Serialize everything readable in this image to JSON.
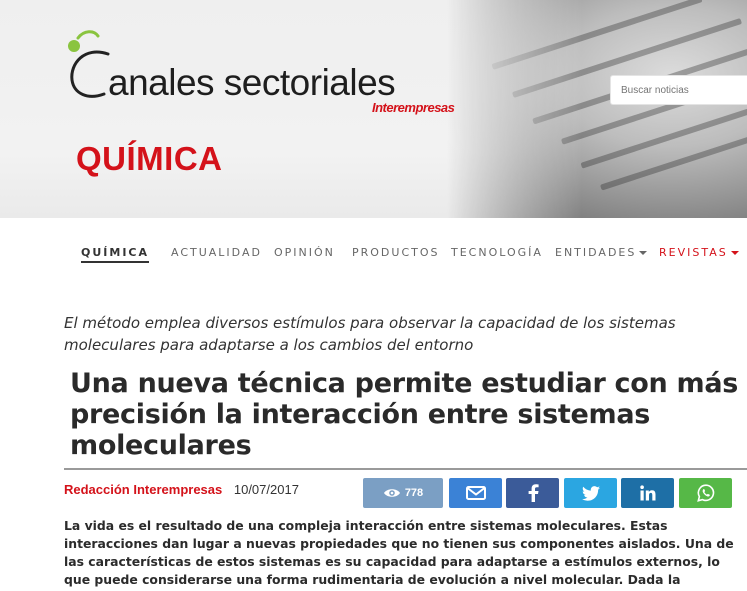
{
  "header": {
    "logo_text": "anales sectoriales",
    "logo_sub": "Interempresas",
    "section_title": "QUÍMICA",
    "search_placeholder": "Buscar noticias",
    "accent_color": "#d4121a",
    "logo_green": "#8ac43f"
  },
  "nav": {
    "items": [
      {
        "label": "QUÍMICA",
        "active": true
      },
      {
        "label": "ACTUALIDAD"
      },
      {
        "label": "OPINIÓN"
      },
      {
        "label": "PRODUCTOS"
      },
      {
        "label": "TECNOLOGÍA"
      },
      {
        "label": "ENTIDADES",
        "dropdown": true
      },
      {
        "label": "REVISTAS",
        "dropdown": true,
        "highlight": true
      }
    ]
  },
  "article": {
    "lead": "El método emplea diversos estímulos para observar la capacidad de los sistemas moleculares para adaptarse a los cambios del entorno",
    "headline": "Una nueva técnica permite estudiar con más precisión la interacción entre sistemas moleculares",
    "author": "Redacción Interempresas",
    "date": "10/07/2017",
    "views": "778",
    "share": [
      "email-icon",
      "facebook-icon",
      "twitter-icon",
      "linkedin-icon",
      "whatsapp-icon"
    ],
    "body": "La vida es el resultado de una compleja interacción entre sistemas moleculares. Estas interacciones dan lugar a nuevas propiedades que no tienen sus componentes aislados. Una de las características de estos sistemas es su capacidad para adaptarse a estímulos externos, lo que puede considerarse una forma rudimentaria de evolución a nivel molecular. Dada la complejidad de estos sistemas, su"
  }
}
